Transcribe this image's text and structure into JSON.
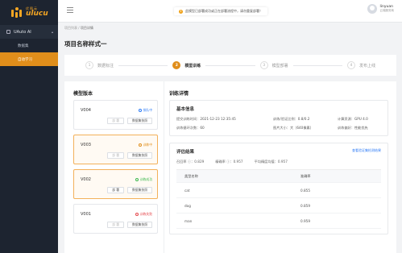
{
  "brand": {
    "cn": "优图云",
    "en": "ulucu"
  },
  "sidebar": {
    "group": "UAuto AI",
    "items": [
      {
        "label": "数据集",
        "active": false
      },
      {
        "label": "自动学习",
        "active": true
      }
    ]
  },
  "topbar": {
    "notice": "此模型已部署成功或正在部署流程中，请勿重复部署！",
    "user": {
      "name": "linyuan",
      "org": "云端服务商"
    }
  },
  "breadcrumb": {
    "parent": "项目列表",
    "sep": " / ",
    "current": "项目详情"
  },
  "page_title": "项目名称样式一",
  "steps": [
    {
      "num": "1",
      "label": "数据标注",
      "active": false
    },
    {
      "num": "2",
      "label": "模型训练",
      "active": true
    },
    {
      "num": "3",
      "label": "模型部署",
      "active": false
    },
    {
      "num": "4",
      "label": "发布上线",
      "active": false
    }
  ],
  "versions_title": "模型版本",
  "versions": [
    {
      "name": "V004",
      "status": "排队中",
      "status_color": "#2f7cf6",
      "deploy": "部 署",
      "deploy_enabled": false,
      "dataset": "数据集快照",
      "selected": false
    },
    {
      "name": "V003",
      "status": "训练中",
      "status_color": "#e08e1b",
      "deploy": "部 署",
      "deploy_enabled": false,
      "dataset": "数据集快照",
      "selected": true
    },
    {
      "name": "V002",
      "status": "训练成功",
      "status_color": "#3fb950",
      "deploy": "部 署",
      "deploy_enabled": true,
      "dataset": "数据集快照",
      "selected": true
    },
    {
      "name": "V001",
      "status": "训练失败",
      "status_color": "#e5484d",
      "deploy": "部 署",
      "deploy_enabled": false,
      "dataset": "数据集快照",
      "selected": false
    }
  ],
  "detail_title": "训练详情",
  "basic": {
    "title": "基本信息",
    "fields": [
      {
        "k": "提交训练时间：",
        "v": "2021-12-23 12:35:45"
      },
      {
        "k": "训练/验证比例：",
        "v": "0.8/0.2"
      },
      {
        "k": "计算资源：",
        "v": "GPU 4.0"
      },
      {
        "k": "训练循环次数：",
        "v": "60"
      },
      {
        "k": "图片大小：",
        "v": "大（640像素）"
      },
      {
        "k": "训练偏好：",
        "v": "性能优先"
      }
    ]
  },
  "eval": {
    "title": "评估结果",
    "link": "查看验证集检测结果",
    "metrics": [
      {
        "k": "召回率 ⓘ：",
        "v": "0.829"
      },
      {
        "k": "精确率 ⓘ：",
        "v": "0.957"
      },
      {
        "k": "平均精度均值：",
        "v": "0.957"
      }
    ],
    "columns": [
      "类型名称",
      "准确率"
    ],
    "rows": [
      [
        "cat",
        "0.855"
      ],
      [
        "dog",
        "0.859"
      ],
      [
        "man",
        "0.959"
      ]
    ]
  }
}
